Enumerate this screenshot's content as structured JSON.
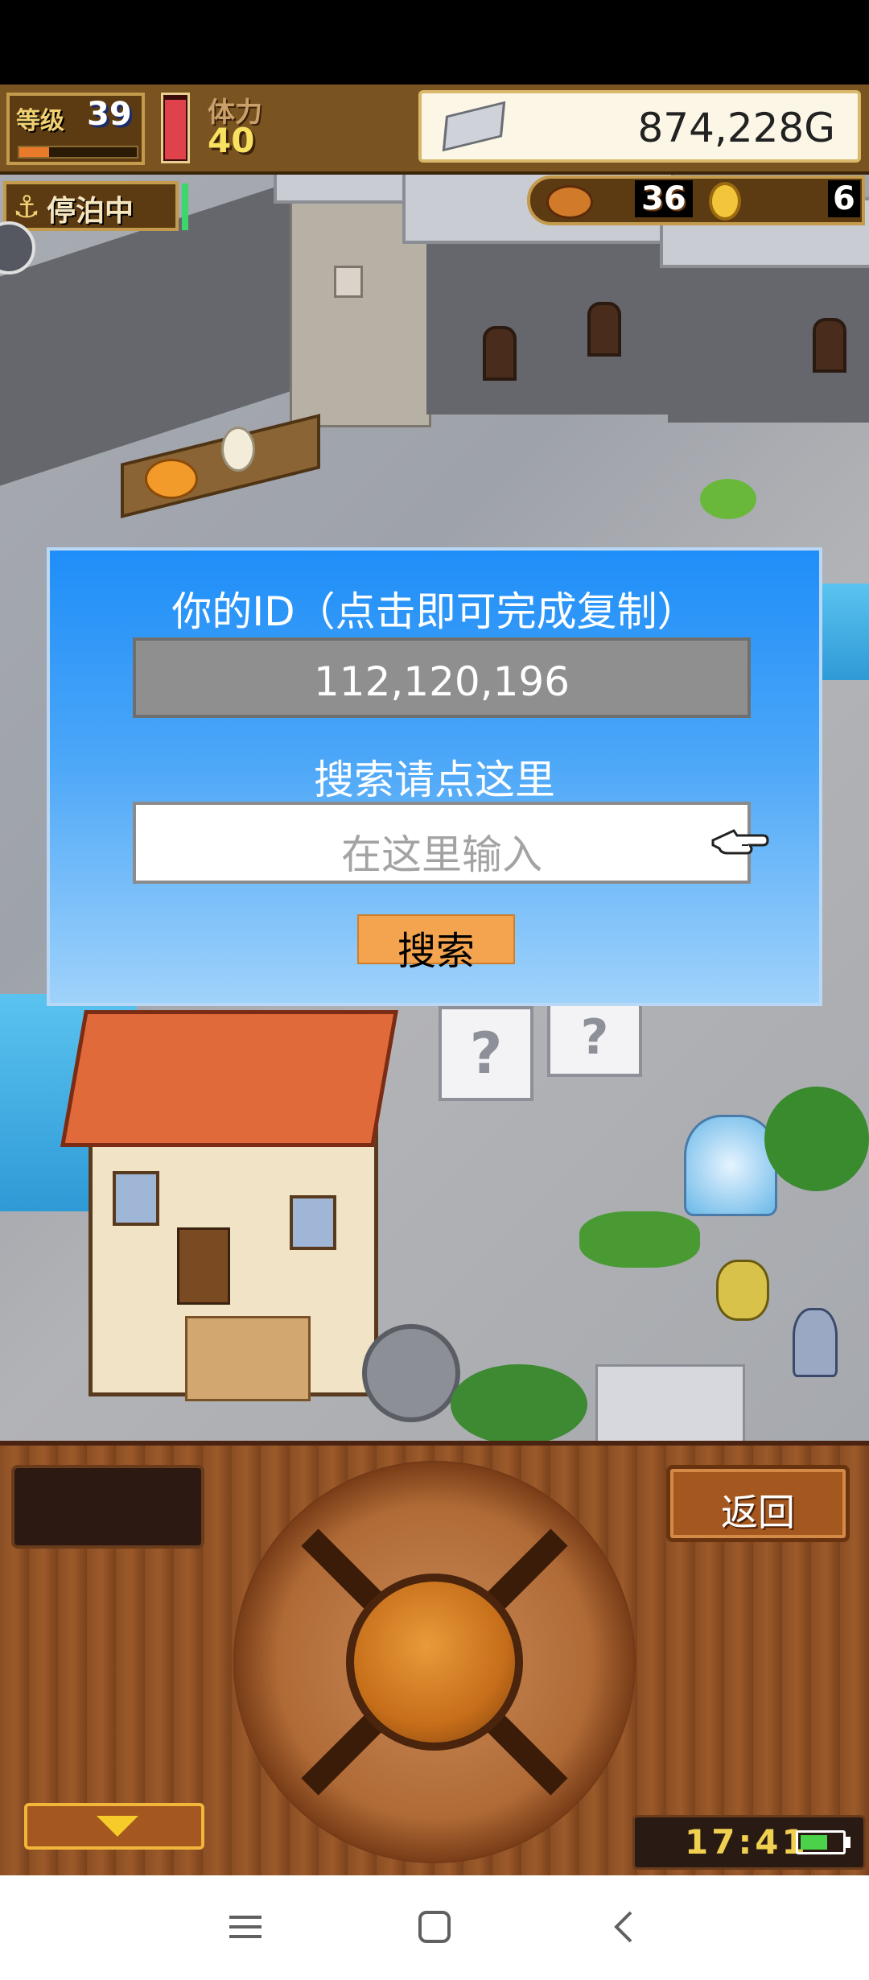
{
  "hud": {
    "level_label": "等级",
    "level_value": "39",
    "level_progress": 0.25,
    "stamina_label": "体力",
    "stamina_value": "40",
    "hp_fill": 0.95,
    "gold_amount": "874,228G",
    "status_label": "停泊中",
    "food_count": "36",
    "coin_count": "6"
  },
  "dialog": {
    "title": "你的ID（点击即可完成复制）",
    "id_value": "112,120,196",
    "search_prompt": "搜索请点这里",
    "search_placeholder": "在这里输入",
    "search_button": "搜索"
  },
  "controls": {
    "back_label": "返回",
    "clock": "17:41",
    "battery_level": 0.7
  },
  "colors": {
    "dialog_top": "#1f8ef8",
    "dialog_bottom": "#9fd2fa",
    "search_button": "#f4a44e",
    "hp_red": "#e0424c",
    "accent_gold": "#f0d070"
  },
  "icons": {
    "gold": "silver-ingot-icon",
    "anchor": "anchor-icon",
    "food": "fish-icon",
    "coin": "coin-icon",
    "pointer": "pointing-hand-icon",
    "menu_toggle": "chevron-down-icon",
    "battery": "battery-icon",
    "nav": [
      "menu-icon",
      "home-icon",
      "back-icon"
    ]
  }
}
